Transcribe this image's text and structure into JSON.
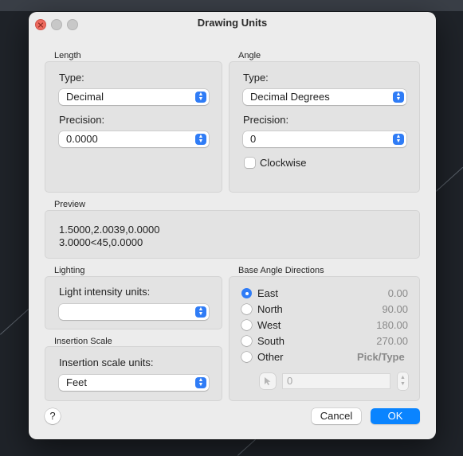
{
  "window": {
    "title": "Drawing Units"
  },
  "length": {
    "section_label": "Length",
    "type_label": "Type:",
    "type_value": "Decimal",
    "precision_label": "Precision:",
    "precision_value": "0.0000"
  },
  "angle": {
    "section_label": "Angle",
    "type_label": "Type:",
    "type_value": "Decimal Degrees",
    "precision_label": "Precision:",
    "precision_value": "0",
    "clockwise_label": "Clockwise",
    "clockwise_checked": false
  },
  "preview": {
    "section_label": "Preview",
    "line1": "1.5000,2.0039,0.0000",
    "line2": "3.0000<45,0.0000"
  },
  "lighting": {
    "section_label": "Lighting",
    "units_label": "Light intensity units:",
    "units_value": ""
  },
  "insertion": {
    "section_label": "Insertion Scale",
    "units_label": "Insertion scale units:",
    "units_value": "Feet"
  },
  "base_angle": {
    "section_label": "Base Angle Directions",
    "options": [
      {
        "label": "East",
        "value": "0.00",
        "selected": true
      },
      {
        "label": "North",
        "value": "90.00",
        "selected": false
      },
      {
        "label": "West",
        "value": "180.00",
        "selected": false
      },
      {
        "label": "South",
        "value": "270.00",
        "selected": false
      },
      {
        "label": "Other",
        "value": "Pick/Type",
        "selected": false
      }
    ],
    "angle_input_value": "0"
  },
  "buttons": {
    "help": "?",
    "cancel": "Cancel",
    "ok": "OK"
  },
  "colors": {
    "accent": "#0a84ff",
    "close_button": "#ed6a5e"
  }
}
